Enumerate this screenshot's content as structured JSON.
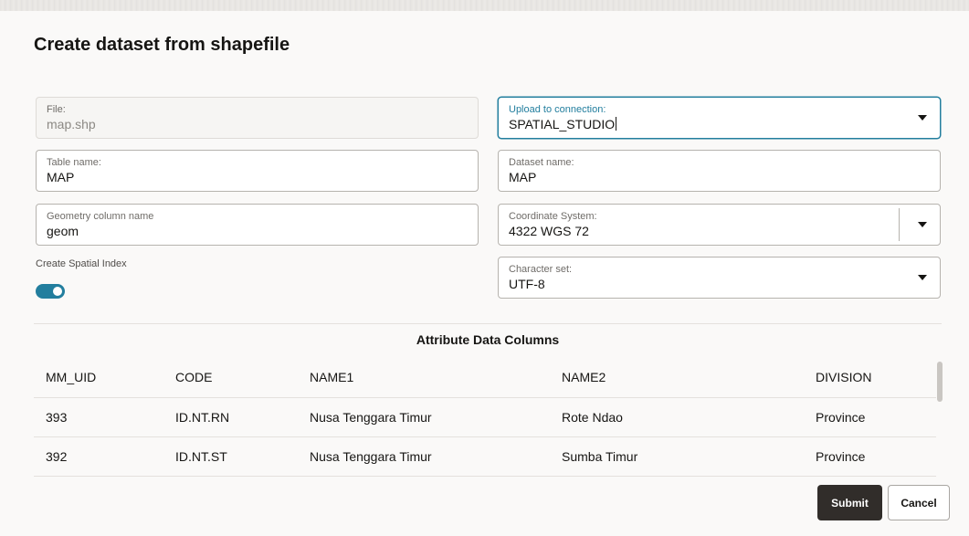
{
  "dialog": {
    "title": "Create dataset from shapefile"
  },
  "fields": {
    "file": {
      "label": "File:",
      "value": "map.shp"
    },
    "connection": {
      "label": "Upload to connection:",
      "value": "SPATIAL_STUDIO"
    },
    "table_name": {
      "label": "Table name:",
      "value": "MAP"
    },
    "dataset_name": {
      "label": "Dataset name:",
      "value": "MAP"
    },
    "geometry_column": {
      "label": "Geometry column name",
      "value": "geom"
    },
    "coordinate_system": {
      "label": "Coordinate System:",
      "value": "4322 WGS 72"
    },
    "character_set": {
      "label": "Character set:",
      "value": "UTF-8"
    }
  },
  "spatial_index": {
    "label": "Create Spatial Index",
    "on": true
  },
  "attributes": {
    "title": "Attribute Data Columns",
    "columns": [
      "MM_UID",
      "CODE",
      "NAME1",
      "NAME2",
      "DIVISION"
    ],
    "rows": [
      [
        "393",
        "ID.NT.RN",
        "Nusa Tenggara Timur",
        "Rote Ndao",
        "Province"
      ],
      [
        "392",
        "ID.NT.ST",
        "Nusa Tenggara Timur",
        "Sumba Timur",
        "Province"
      ]
    ]
  },
  "buttons": {
    "submit": "Submit",
    "cancel": "Cancel"
  },
  "colors": {
    "accent": "#227e9e",
    "primary_button": "#312d2a"
  }
}
